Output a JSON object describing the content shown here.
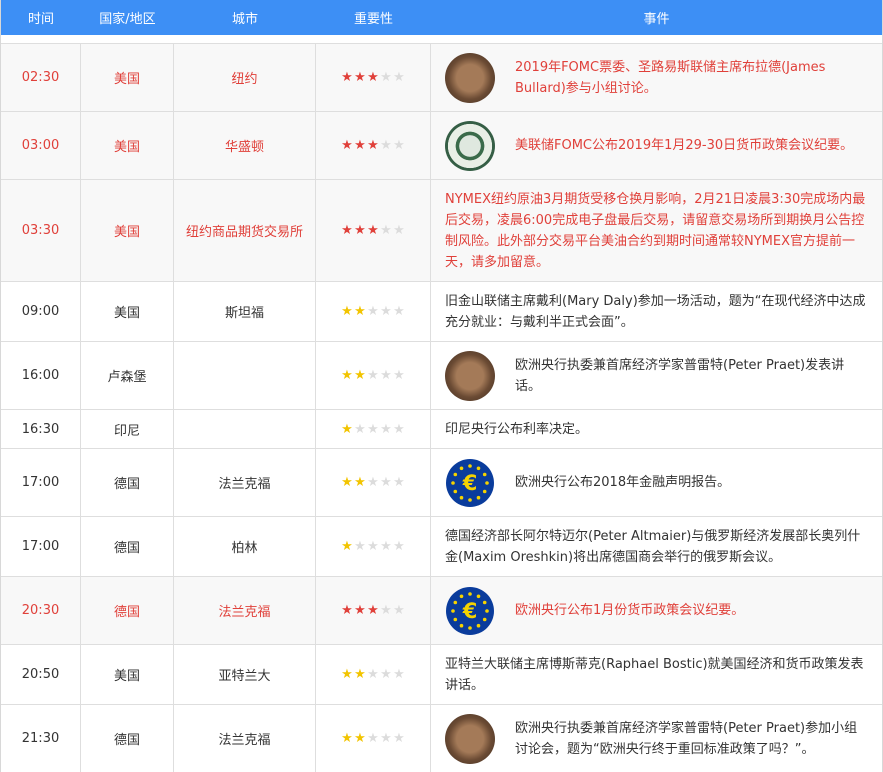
{
  "headers": [
    "时间",
    "国家/地区",
    "城市",
    "重要性",
    "事件"
  ],
  "colors": {
    "header_bg": "#3d8ff5",
    "highlight_text": "#e0403a",
    "star_high": "#e0403a",
    "star_normal": "#f2c400",
    "star_off": "#dcdcdc"
  },
  "rows": [
    {
      "time": "02:30",
      "country": "美国",
      "city": "纽约",
      "stars": 3,
      "highlight": true,
      "icon": "person-photo-icon",
      "event": "2019年FOMC票委、圣路易斯联储主席布拉德(James Bullard)参与小组讨论。"
    },
    {
      "time": "03:00",
      "country": "美国",
      "city": "华盛顿",
      "stars": 3,
      "highlight": true,
      "icon": "federal-reserve-seal-icon",
      "event": "美联储FOMC公布2019年1月29-30日货币政策会议纪要。"
    },
    {
      "time": "03:30",
      "country": "美国",
      "city": "纽约商品期货交易所",
      "stars": 3,
      "highlight": true,
      "icon": "",
      "event": "NYMEX纽约原油3月期货受移仓换月影响，2月21日凌晨3:30完成场内最后交易，凌晨6:00完成电子盘最后交易，请留意交易场所到期换月公告控制风险。此外部分交易平台美油合约到期时间通常较NYMEX官方提前一天，请多加留意。"
    },
    {
      "time": "09:00",
      "country": "美国",
      "city": "斯坦福",
      "stars": 2,
      "highlight": false,
      "icon": "",
      "event": "旧金山联储主席戴利(Mary Daly)参加一场活动，题为“在现代经济中达成充分就业：与戴利半正式会面”。"
    },
    {
      "time": "16:00",
      "country": "卢森堡",
      "city": "",
      "stars": 2,
      "highlight": false,
      "icon": "person-photo-icon",
      "event": "欧洲央行执委兼首席经济学家普雷特(Peter Praet)发表讲话。"
    },
    {
      "time": "16:30",
      "country": "印尼",
      "city": "",
      "stars": 1,
      "highlight": false,
      "icon": "",
      "event": "印尼央行公布利率决定。"
    },
    {
      "time": "17:00",
      "country": "德国",
      "city": "法兰克福",
      "stars": 2,
      "highlight": false,
      "icon": "euro-logo-icon",
      "event": "欧洲央行公布2018年金融声明报告。"
    },
    {
      "time": "17:00",
      "country": "德国",
      "city": "柏林",
      "stars": 1,
      "highlight": false,
      "icon": "",
      "event": "德国经济部长阿尔特迈尔(Peter Altmaier)与俄罗斯经济发展部长奥列什金(Maxim Oreshkin)将出席德国商会举行的俄罗斯会议。"
    },
    {
      "time": "20:30",
      "country": "德国",
      "city": "法兰克福",
      "stars": 3,
      "highlight": true,
      "icon": "euro-logo-icon",
      "event": "欧洲央行公布1月份货币政策会议纪要。"
    },
    {
      "time": "20:50",
      "country": "美国",
      "city": "亚特兰大",
      "stars": 2,
      "highlight": false,
      "icon": "",
      "event": "亚特兰大联储主席博斯蒂克(Raphael Bostic)就美国经济和货币政策发表讲话。"
    },
    {
      "time": "21:30",
      "country": "德国",
      "city": "法兰克福",
      "stars": 2,
      "highlight": false,
      "icon": "person-photo-icon",
      "event": "欧洲央行执委兼首席经济学家普雷特(Peter Praet)参加小组讨论会，题为“欧洲央行终于重回标准政策了吗？”。"
    }
  ]
}
